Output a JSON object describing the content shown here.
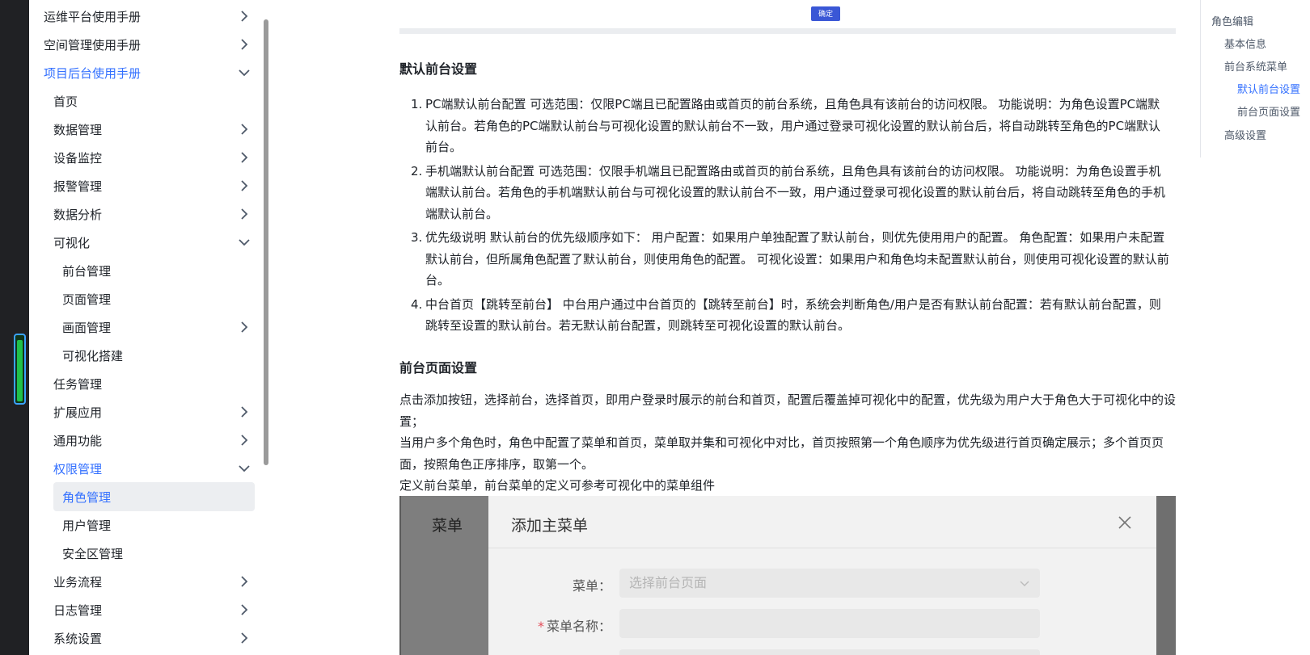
{
  "sidebar": {
    "items": [
      {
        "label": "运维平台使用手册",
        "level": 0,
        "chevron": "right"
      },
      {
        "label": "空间管理使用手册",
        "level": 0,
        "chevron": "right"
      },
      {
        "label": "项目后台使用手册",
        "level": 0,
        "chevron": "down",
        "active": true
      },
      {
        "label": "首页",
        "level": 1,
        "chevron": ""
      },
      {
        "label": "数据管理",
        "level": 1,
        "chevron": "right"
      },
      {
        "label": "设备监控",
        "level": 1,
        "chevron": "right"
      },
      {
        "label": "报警管理",
        "level": 1,
        "chevron": "right"
      },
      {
        "label": "数据分析",
        "level": 1,
        "chevron": "right"
      },
      {
        "label": "可视化",
        "level": 1,
        "chevron": "down"
      },
      {
        "label": "前台管理",
        "level": 2,
        "chevron": ""
      },
      {
        "label": "页面管理",
        "level": 2,
        "chevron": ""
      },
      {
        "label": "画面管理",
        "level": 2,
        "chevron": "right"
      },
      {
        "label": "可视化搭建",
        "level": 2,
        "chevron": ""
      },
      {
        "label": "任务管理",
        "level": 1,
        "chevron": ""
      },
      {
        "label": "扩展应用",
        "level": 1,
        "chevron": "right"
      },
      {
        "label": "通用功能",
        "level": 1,
        "chevron": "right"
      },
      {
        "label": "权限管理",
        "level": 1,
        "chevron": "down",
        "active": true
      },
      {
        "label": "角色管理",
        "level": 2,
        "chevron": "",
        "active": true,
        "selected": true
      },
      {
        "label": "用户管理",
        "level": 2,
        "chevron": ""
      },
      {
        "label": "安全区管理",
        "level": 2,
        "chevron": ""
      },
      {
        "label": "业务流程",
        "level": 1,
        "chevron": "right"
      },
      {
        "label": "日志管理",
        "level": 1,
        "chevron": "right"
      },
      {
        "label": "系统设置",
        "level": 1,
        "chevron": "right"
      }
    ]
  },
  "left_progress": {
    "value_percent": 90,
    "color": "#1fc24a"
  },
  "content": {
    "ok_button": "确定",
    "section1_title": "默认前台设置",
    "list": [
      {
        "num": "1.",
        "text": "PC端默认前台配置 可选范围：仅限PC端且已配置路由或首页的前台系统，且角色具有该前台的访问权限。 功能说明：为角色设置PC端默认前台。若角色的PC端默认前台与可视化设置的默认前台不一致，用户通过登录可视化设置的默认前台后，将自动跳转至角色的PC端默认前台。"
      },
      {
        "num": "2.",
        "text": "手机端默认前台配置 可选范围：仅限手机端且已配置路由或首页的前台系统，且角色具有该前台的访问权限。 功能说明：为角色设置手机端默认前台。若角色的手机端默认前台与可视化设置的默认前台不一致，用户通过登录可视化设置的默认前台后，将自动跳转至角色的手机端默认前台。"
      },
      {
        "num": "3.",
        "text": "优先级说明 默认前台的优先级顺序如下： 用户配置：如果用户单独配置了默认前台，则优先使用用户的配置。 角色配置：如果用户未配置默认前台，但所属角色配置了默认前台，则使用角色的配置。 可视化设置：如果用户和角色均未配置默认前台，则使用可视化设置的默认前台。"
      },
      {
        "num": "4.",
        "text": "中台首页【跳转至前台】 中台用户通过中台首页的【跳转至前台】时，系统会判断角色/用户是否有默认前台配置：若有默认前台配置，则跳转至设置的默认前台。若无默认前台配置，则跳转至可视化设置的默认前台。"
      }
    ],
    "section2_title": "前台页面设置",
    "para1": "点击添加按钮，选择前台，选择首页，即用户登录时展示的前台和首页，配置后覆盖掉可视化中的配置，优先级为用户大于角色大于可视化中的设置；",
    "para2": "当用户多个角色时，角色中配置了菜单和首页，菜单取并集和可视化中对比，首页按照第一个角色顺序为优先级进行首页确定展示；多个首页页面，按照角色正序排序，取第一个。",
    "para3": "定义前台菜单，前台菜单的定义可参考可视化中的菜单组件"
  },
  "screenshot": {
    "bg_title": "菜单",
    "dialog_title": "添加主菜单",
    "menu_label": "菜单：",
    "menu_placeholder": "选择前台页面",
    "name_required": "*",
    "name_label": "菜单名称："
  },
  "toc": {
    "items": [
      {
        "label": "角色编辑",
        "indent": 0
      },
      {
        "label": "基本信息",
        "indent": 1
      },
      {
        "label": "前台系统菜单",
        "indent": 1
      },
      {
        "label": "默认前台设置",
        "indent": 2,
        "active": true
      },
      {
        "label": "前台页面设置",
        "indent": 2
      },
      {
        "label": "高级设置",
        "indent": 1
      }
    ]
  },
  "colors": {
    "accent": "#3370ff",
    "selected_bg": "#eceef1",
    "button": "#3a57d6"
  }
}
